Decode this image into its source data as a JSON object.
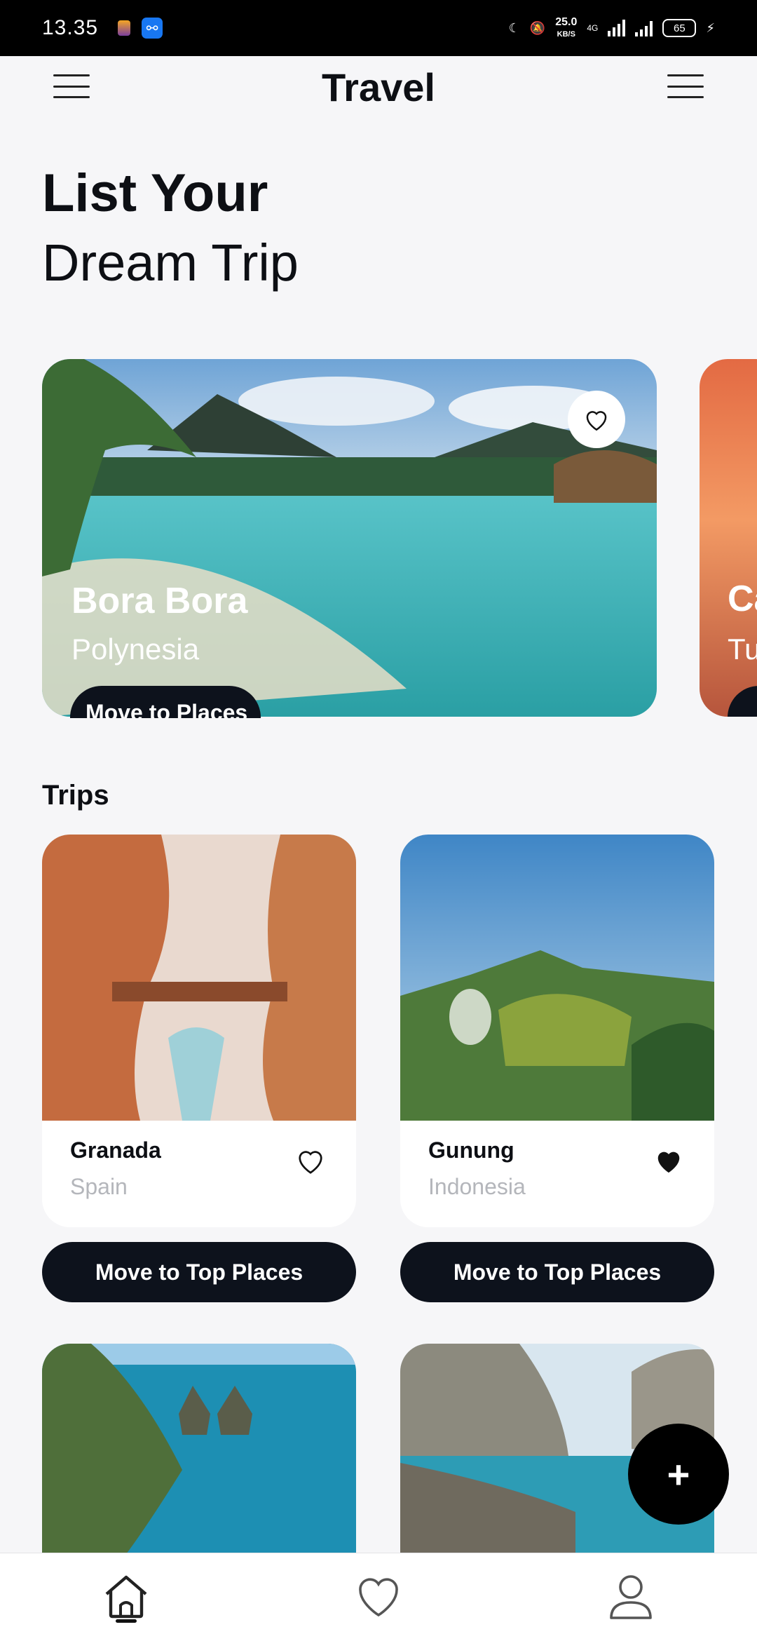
{
  "status_bar": {
    "time": "13.35",
    "speed": "25.0",
    "speed_unit": "KB/S",
    "network": "4G",
    "battery": "65"
  },
  "header": {
    "title": "Travel"
  },
  "hero": {
    "title": "List Your",
    "subtitle": "Dream Trip"
  },
  "featured": {
    "place": "Bora Bora",
    "region": "Polynesia",
    "button": "Move to Places",
    "next_place": "Ca",
    "next_region": "Tu"
  },
  "trips": {
    "section_title": "Trips",
    "items": [
      {
        "name": "Granada",
        "country": "Spain",
        "favorite": false,
        "button": "Move to Top Places"
      },
      {
        "name": "Gunung",
        "country": "Indonesia",
        "favorite": true,
        "button": "Move to Top Places"
      }
    ]
  },
  "fab": {
    "label": "+"
  },
  "colors": {
    "accent": "#0d121c",
    "muted": "#b4b6bb",
    "background": "#f6f6f8"
  },
  "nav": {
    "items": [
      "home-icon",
      "heart-icon",
      "profile-icon"
    ],
    "active": "home-icon"
  }
}
